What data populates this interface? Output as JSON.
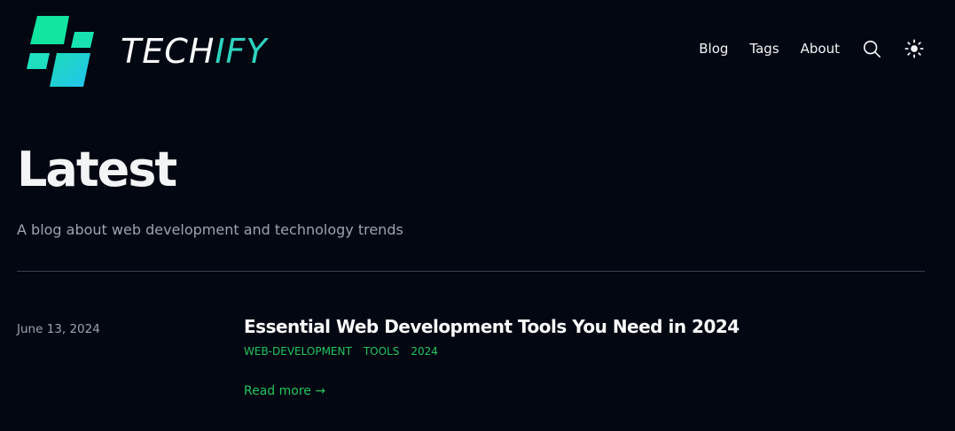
{
  "header": {
    "brand_part1": "TECH",
    "brand_part2": "IFY",
    "logo_icon": "techify-logo-icon",
    "nav": {
      "blog": "Blog",
      "tags": "Tags",
      "about": "About"
    },
    "search_icon": "search-icon",
    "theme_icon": "sun-icon"
  },
  "hero": {
    "title": "Latest",
    "subtitle": "A blog about web development and technology trends"
  },
  "posts": [
    {
      "date": "June 13, 2024",
      "title": "Essential Web Development Tools You Need in 2024",
      "tags": [
        "web-development",
        "tools",
        "2024"
      ],
      "read_more": "Read more →"
    }
  ],
  "colors": {
    "background": "#030712",
    "accent": "#22c55e",
    "brand_accent": "#2dd4bf",
    "muted_text": "#9ca3af"
  }
}
